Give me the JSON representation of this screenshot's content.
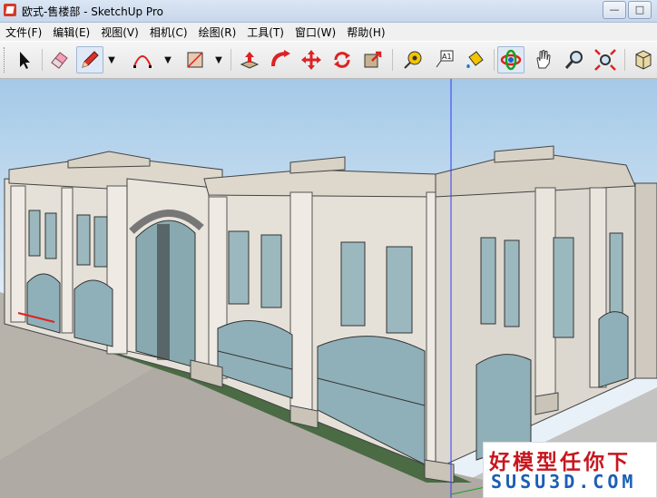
{
  "window": {
    "title": "欧式-售楼部 - SketchUp Pro",
    "minimize": "—",
    "maximize": "□",
    "close": "✕"
  },
  "menu": [
    "文件(F)",
    "编辑(E)",
    "视图(V)",
    "相机(C)",
    "绘图(R)",
    "工具(T)",
    "窗口(W)",
    "帮助(H)"
  ],
  "toolbar": {
    "tools": [
      "select-icon",
      "eraser-icon",
      "pencil-icon",
      "arc-icon",
      "rectangle-icon",
      "push-pull-icon",
      "follow-me-icon",
      "move-icon",
      "rotate-icon",
      "scale-icon",
      "tape-measure-icon",
      "text-icon",
      "paint-bucket-icon",
      "orbit-icon",
      "pan-icon",
      "zoom-icon",
      "zoom-extents-icon",
      "component-icon"
    ],
    "active_tool": "orbit-icon",
    "text_tool_label": "A1"
  },
  "colors": {
    "sky_top": "#a4c9e8",
    "facade": "#e6e1d8",
    "glass": "#9bb8bf",
    "axis_blue": "#2c3cf0",
    "axis_red": "#e02020",
    "axis_green": "#1aa01a"
  },
  "watermark": {
    "cn": "好模型任你下",
    "en": "SUSU3D.COM"
  }
}
